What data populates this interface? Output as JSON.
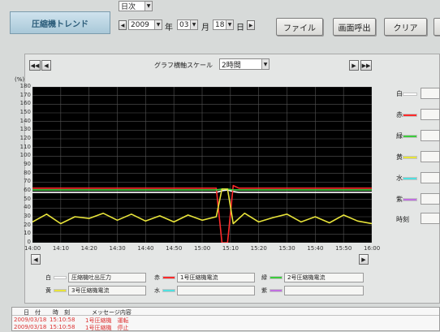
{
  "header": {
    "title": "圧縮機トレンド",
    "mode_value": "日次",
    "year_value": "2009",
    "year_unit": "年",
    "month_value": "03",
    "month_unit": "月",
    "day_value": "18",
    "day_unit": "日",
    "file_label": "ファイル",
    "screen_call_label": "画面呼出",
    "clear_label": "クリア"
  },
  "graph": {
    "scale_label": "グラフ横軸スケール",
    "scale_value": "2時間",
    "y_unit": "(%)",
    "y_ticks": [
      "180",
      "170",
      "160",
      "150",
      "140",
      "130",
      "120",
      "110",
      "100",
      "90",
      "80",
      "70",
      "60",
      "50",
      "40",
      "30",
      "20",
      "10",
      "0"
    ],
    "x_ticks": [
      "14:00",
      "14:10",
      "14:20",
      "14:30",
      "14:40",
      "14:50",
      "15:00",
      "15:10",
      "15:20",
      "15:30",
      "15:40",
      "15:50",
      "16:00"
    ]
  },
  "right_panel": {
    "items": [
      {
        "label": "白",
        "color": "#ffffff"
      },
      {
        "label": "赤",
        "color": "#ff2a2a"
      },
      {
        "label": "緑",
        "color": "#3ccb3c"
      },
      {
        "label": "黄",
        "color": "#e8e43a"
      },
      {
        "label": "水",
        "color": "#4fe0e0"
      },
      {
        "label": "紫",
        "color": "#c070e0"
      }
    ],
    "time_label": "時刻"
  },
  "legend": {
    "rows": [
      [
        {
          "label": "白",
          "color": "#ffffff",
          "name": "圧縮機吐出圧力"
        },
        {
          "label": "赤",
          "color": "#ff2a2a",
          "name": "1号圧縮機電流"
        },
        {
          "label": "緑",
          "color": "#3ccb3c",
          "name": "2号圧縮機電流"
        }
      ],
      [
        {
          "label": "黄",
          "color": "#e8e43a",
          "name": "3号圧縮機電流"
        },
        {
          "label": "水",
          "color": "#4fe0e0",
          "name": ""
        },
        {
          "label": "紫",
          "color": "#c070e0",
          "name": ""
        }
      ]
    ]
  },
  "messages": {
    "headers": [
      "日　付",
      "時　刻",
      "メッセージ内容"
    ],
    "rows": [
      {
        "date": "2009/03/18",
        "time": "15:10:58",
        "text": "1号圧縮機　運転"
      },
      {
        "date": "2009/03/18",
        "time": "15:10:58",
        "text": "1号圧縮機　停止"
      }
    ]
  },
  "chart_data": {
    "type": "line",
    "ylabel": "(%)",
    "ylim": [
      0,
      180
    ],
    "x": [
      "14:00",
      "14:05",
      "14:10",
      "14:15",
      "14:20",
      "14:25",
      "14:30",
      "14:35",
      "14:40",
      "14:45",
      "14:50",
      "14:55",
      "15:00",
      "15:05",
      "15:07",
      "15:09",
      "15:11",
      "15:13",
      "15:15",
      "15:20",
      "15:25",
      "15:30",
      "15:35",
      "15:40",
      "15:45",
      "15:50",
      "15:55",
      "16:00"
    ],
    "grid": true,
    "series": [
      {
        "name": "白",
        "color": "#ffffff",
        "values": [
          58,
          58,
          58,
          58,
          58,
          58,
          58,
          58,
          58,
          58,
          58,
          58,
          58,
          58,
          60,
          61,
          59,
          58,
          58,
          58,
          58,
          58,
          58,
          58,
          58,
          58,
          58,
          58
        ]
      },
      {
        "name": "赤",
        "color": "#ff2a2a",
        "values": [
          63,
          63,
          63,
          63,
          63,
          63,
          63,
          63,
          63,
          63,
          63,
          63,
          63,
          63,
          0,
          0,
          66,
          63,
          63,
          63,
          63,
          63,
          63,
          63,
          63,
          63,
          63,
          63
        ]
      },
      {
        "name": "緑",
        "color": "#3ccb3c",
        "values": [
          61,
          61,
          61,
          61,
          61,
          61,
          61,
          61,
          61,
          61,
          61,
          61,
          61,
          61,
          62,
          62,
          61,
          61,
          61,
          61,
          61,
          61,
          61,
          61,
          61,
          61,
          61,
          61
        ]
      },
      {
        "name": "黄",
        "color": "#e8e43a",
        "values": [
          24,
          33,
          22,
          30,
          28,
          34,
          26,
          33,
          25,
          31,
          24,
          32,
          26,
          30,
          62,
          62,
          22,
          28,
          34,
          24,
          29,
          33,
          24,
          30,
          23,
          32,
          25,
          22
        ]
      }
    ]
  }
}
